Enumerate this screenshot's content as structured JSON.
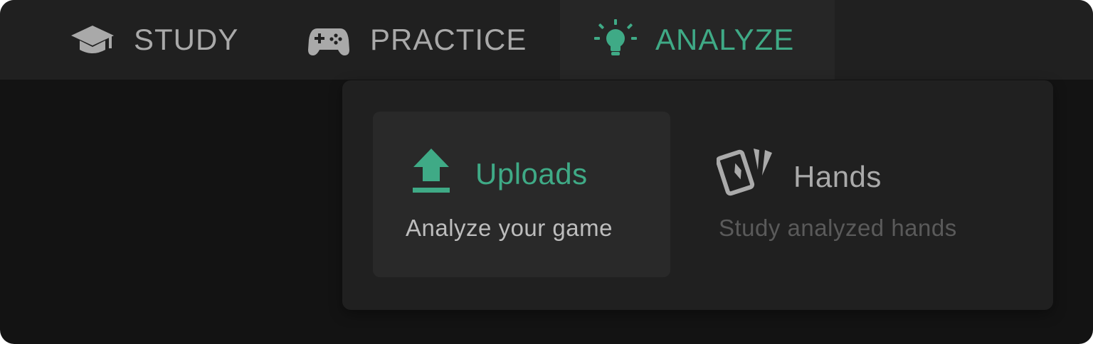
{
  "nav": {
    "tabs": [
      {
        "label": "STUDY",
        "icon": "graduation-cap-icon",
        "active": false
      },
      {
        "label": "PRACTICE",
        "icon": "gamepad-icon",
        "active": false
      },
      {
        "label": "ANALYZE",
        "icon": "lightbulb-icon",
        "active": true
      }
    ]
  },
  "dropdown": {
    "items": [
      {
        "title": "Uploads",
        "subtitle": "Analyze your game",
        "icon": "upload-icon",
        "highlighted": true
      },
      {
        "title": "Hands",
        "subtitle": "Study analyzed hands",
        "icon": "cards-icon",
        "highlighted": false
      }
    ]
  },
  "colors": {
    "accent": "#3faa86",
    "background": "#131313",
    "navbar": "#202020",
    "active_tab": "#262626",
    "muted_text": "#a9a9a9"
  }
}
